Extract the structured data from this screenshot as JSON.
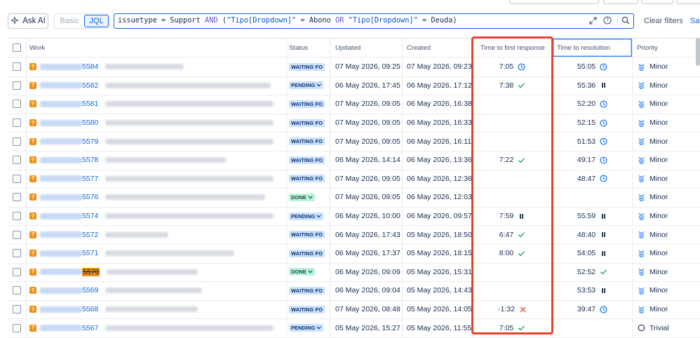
{
  "toolbar": {
    "ask_ai_label": "Ask AI",
    "mode_basic": "Basic",
    "mode_jql": "JQL",
    "query_tokens": [
      {
        "t": "issuetype",
        "k": "ident"
      },
      {
        "t": " = ",
        "k": "ident"
      },
      {
        "t": "Support",
        "k": "ident"
      },
      {
        "t": " AND ",
        "k": "kw"
      },
      {
        "t": "(",
        "k": "ident"
      },
      {
        "t": "\"Tipo[Dropdown]\"",
        "k": "str"
      },
      {
        "t": " = ",
        "k": "ident"
      },
      {
        "t": "Abono",
        "k": "ident"
      },
      {
        "t": " OR ",
        "k": "kw"
      },
      {
        "t": "\"Tipo[Dropdown]\"",
        "k": "str"
      },
      {
        "t": " = ",
        "k": "ident"
      },
      {
        "t": "Deuda",
        "k": "ident"
      },
      {
        "t": ")",
        "k": "ident"
      }
    ],
    "clear_filters": "Clear filters",
    "save_label": "Sav"
  },
  "columns": {
    "work": "Work",
    "status": "Status",
    "updated": "Updated",
    "created": "Created",
    "time_first_response": "Time to first response",
    "time_resolution": "Time to resolution",
    "priority": "Priority"
  },
  "colors": {
    "accent": "#0c66e4",
    "highlight_box": "#e8412e",
    "sla_ok": "#22a06b",
    "sla_breach": "#e34935"
  },
  "rows": [
    {
      "key": "5584",
      "summary_w": 112,
      "status": "WAITING FO",
      "status_type": "waiting",
      "updated": "07 May 2026, 09:25",
      "created": "07 May 2026, 09:23",
      "tfr": "7:05",
      "tfr_icon": "clock",
      "ttr": "55:05",
      "ttr_icon": "clock",
      "priority": "Minor",
      "priority_icon": "minor"
    },
    {
      "key": "5582",
      "summary_w": 236,
      "status": "PENDING",
      "status_type": "pending",
      "updated": "06 May 2026, 17:45",
      "created": "06 May 2026, 17:12",
      "tfr": "7:38",
      "tfr_icon": "check",
      "ttr": "55:36",
      "ttr_icon": "pause",
      "priority": "Minor",
      "priority_icon": "minor"
    },
    {
      "key": "5581",
      "summary_w": 240,
      "status": "WAITING FO",
      "status_type": "waiting",
      "updated": "07 May 2026, 09:05",
      "created": "06 May 2026, 16:38",
      "tfr": "",
      "tfr_icon": "",
      "ttr": "52:20",
      "ttr_icon": "clock",
      "priority": "Minor",
      "priority_icon": "minor"
    },
    {
      "key": "5580",
      "summary_w": 240,
      "status": "WAITING FO",
      "status_type": "waiting",
      "updated": "07 May 2026, 09:05",
      "created": "06 May 2026, 16:33",
      "tfr": "",
      "tfr_icon": "",
      "ttr": "52:15",
      "ttr_icon": "clock",
      "priority": "Minor",
      "priority_icon": "minor"
    },
    {
      "key": "5579",
      "summary_w": 240,
      "status": "WAITING FO",
      "status_type": "waiting",
      "updated": "07 May 2026, 09:05",
      "created": "06 May 2026, 16:11",
      "tfr": "",
      "tfr_icon": "",
      "ttr": "51:53",
      "ttr_icon": "clock",
      "priority": "Minor",
      "priority_icon": "minor"
    },
    {
      "key": "5578",
      "summary_w": 172,
      "status": "WAITING FO",
      "status_type": "waiting",
      "updated": "06 May 2026, 14:14",
      "created": "06 May 2026, 13:36",
      "tfr": "7:22",
      "tfr_icon": "check",
      "ttr": "49:17",
      "ttr_icon": "clock",
      "priority": "Minor",
      "priority_icon": "minor"
    },
    {
      "key": "5577",
      "summary_w": 240,
      "status": "WAITING FO",
      "status_type": "waiting",
      "updated": "07 May 2026, 09:05",
      "created": "06 May 2026, 12:36",
      "tfr": "",
      "tfr_icon": "",
      "ttr": "48:47",
      "ttr_icon": "clock",
      "priority": "Minor",
      "priority_icon": "minor"
    },
    {
      "key": "5576",
      "summary_w": 228,
      "status": "DONE",
      "status_type": "done",
      "updated": "07 May 2026, 09:05",
      "created": "06 May 2026, 12:03",
      "tfr": "",
      "tfr_icon": "",
      "ttr": "",
      "ttr_icon": "",
      "priority": "Minor",
      "priority_icon": "minor"
    },
    {
      "key": "5574",
      "summary_w": 240,
      "status": "PENDING",
      "status_type": "pending",
      "updated": "06 May 2026, 10:00",
      "created": "06 May 2026, 09:57",
      "tfr": "7:59",
      "tfr_icon": "pause",
      "ttr": "55:59",
      "ttr_icon": "pause",
      "priority": "Minor",
      "priority_icon": "minor"
    },
    {
      "key": "5572",
      "summary_w": 90,
      "status": "WAITING FO",
      "status_type": "waiting",
      "updated": "06 May 2026, 17:43",
      "created": "05 May 2026, 18:50",
      "tfr": "6:47",
      "tfr_icon": "check",
      "ttr": "48:40",
      "ttr_icon": "pause",
      "priority": "Minor",
      "priority_icon": "minor"
    },
    {
      "key": "5571",
      "summary_w": 184,
      "status": "WAITING FO",
      "status_type": "waiting",
      "updated": "06 May 2026, 17:37",
      "created": "05 May 2026, 18:15",
      "tfr": "8:00",
      "tfr_icon": "check",
      "ttr": "54:05",
      "ttr_icon": "pause",
      "priority": "Minor",
      "priority_icon": "minor"
    },
    {
      "key": "5570",
      "summary_w": 130,
      "status": "DONE",
      "status_type": "done",
      "updated": "06 May 2026, 09:09",
      "created": "05 May 2026, 15:31",
      "tfr": "",
      "tfr_icon": "",
      "ttr": "52:52",
      "ttr_icon": "check",
      "priority": "Minor",
      "priority_icon": "minor",
      "highlight": true
    },
    {
      "key": "5569",
      "summary_w": 138,
      "status": "WAITING FO",
      "status_type": "waiting",
      "updated": "06 May 2026, 09:04",
      "created": "05 May 2026, 14:43",
      "tfr": "",
      "tfr_icon": "",
      "ttr": "53:53",
      "ttr_icon": "pause",
      "priority": "Minor",
      "priority_icon": "minor"
    },
    {
      "key": "5568",
      "summary_w": 132,
      "status": "WAITING FO",
      "status_type": "waiting",
      "updated": "07 May 2026, 08:48",
      "created": "05 May 2026, 14:05",
      "tfr": "-1:32",
      "tfr_icon": "cross",
      "ttr": "39:47",
      "ttr_icon": "clock",
      "priority": "Minor",
      "priority_icon": "minor"
    },
    {
      "key": "5567",
      "summary_w": 240,
      "status": "PENDING",
      "status_type": "pending",
      "updated": "05 May 2026, 15:27",
      "created": "05 May 2026, 11:55",
      "tfr": "7:05",
      "tfr_icon": "check",
      "ttr": "",
      "ttr_icon": "",
      "priority": "Trivial",
      "priority_icon": "trivial"
    }
  ]
}
